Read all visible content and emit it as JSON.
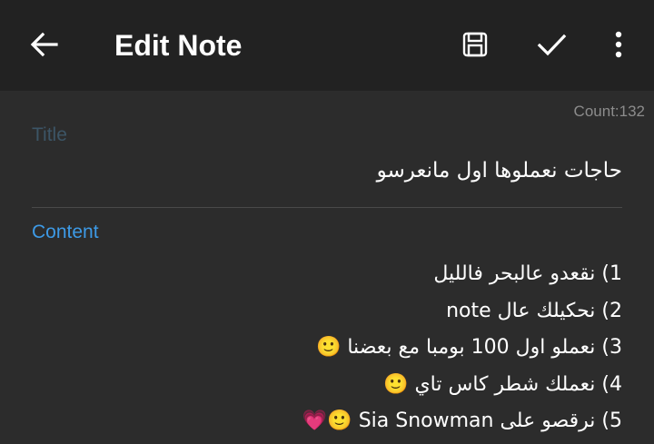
{
  "appbar": {
    "title": "Edit Note",
    "icons": {
      "back": "arrow-left-icon",
      "save": "floppy-disk-icon",
      "done": "checkmark-icon",
      "more": "more-vertical-icon"
    }
  },
  "count": "Count:132",
  "title_field": {
    "label": "Title",
    "value": "حاجات نعملوها اول مانعرسو"
  },
  "content_field": {
    "label": "Content",
    "lines": [
      "1) نقعدو عالبحر فالليل",
      "2) نحكيلك عال note",
      "3) نعملو اول 100 بومبا مع بعضنا 🙂",
      "4) نعملك شطر كاس تاي 🙂",
      "5) نرقصو على Sia Snowman 🙂💗"
    ]
  },
  "colors": {
    "appbar_bg": "#222222",
    "body_bg": "#2c2c2c",
    "accent": "#3d9ae6",
    "title_hint": "#3c5566",
    "text": "#ffffff",
    "count_text": "#8c8c8c"
  }
}
